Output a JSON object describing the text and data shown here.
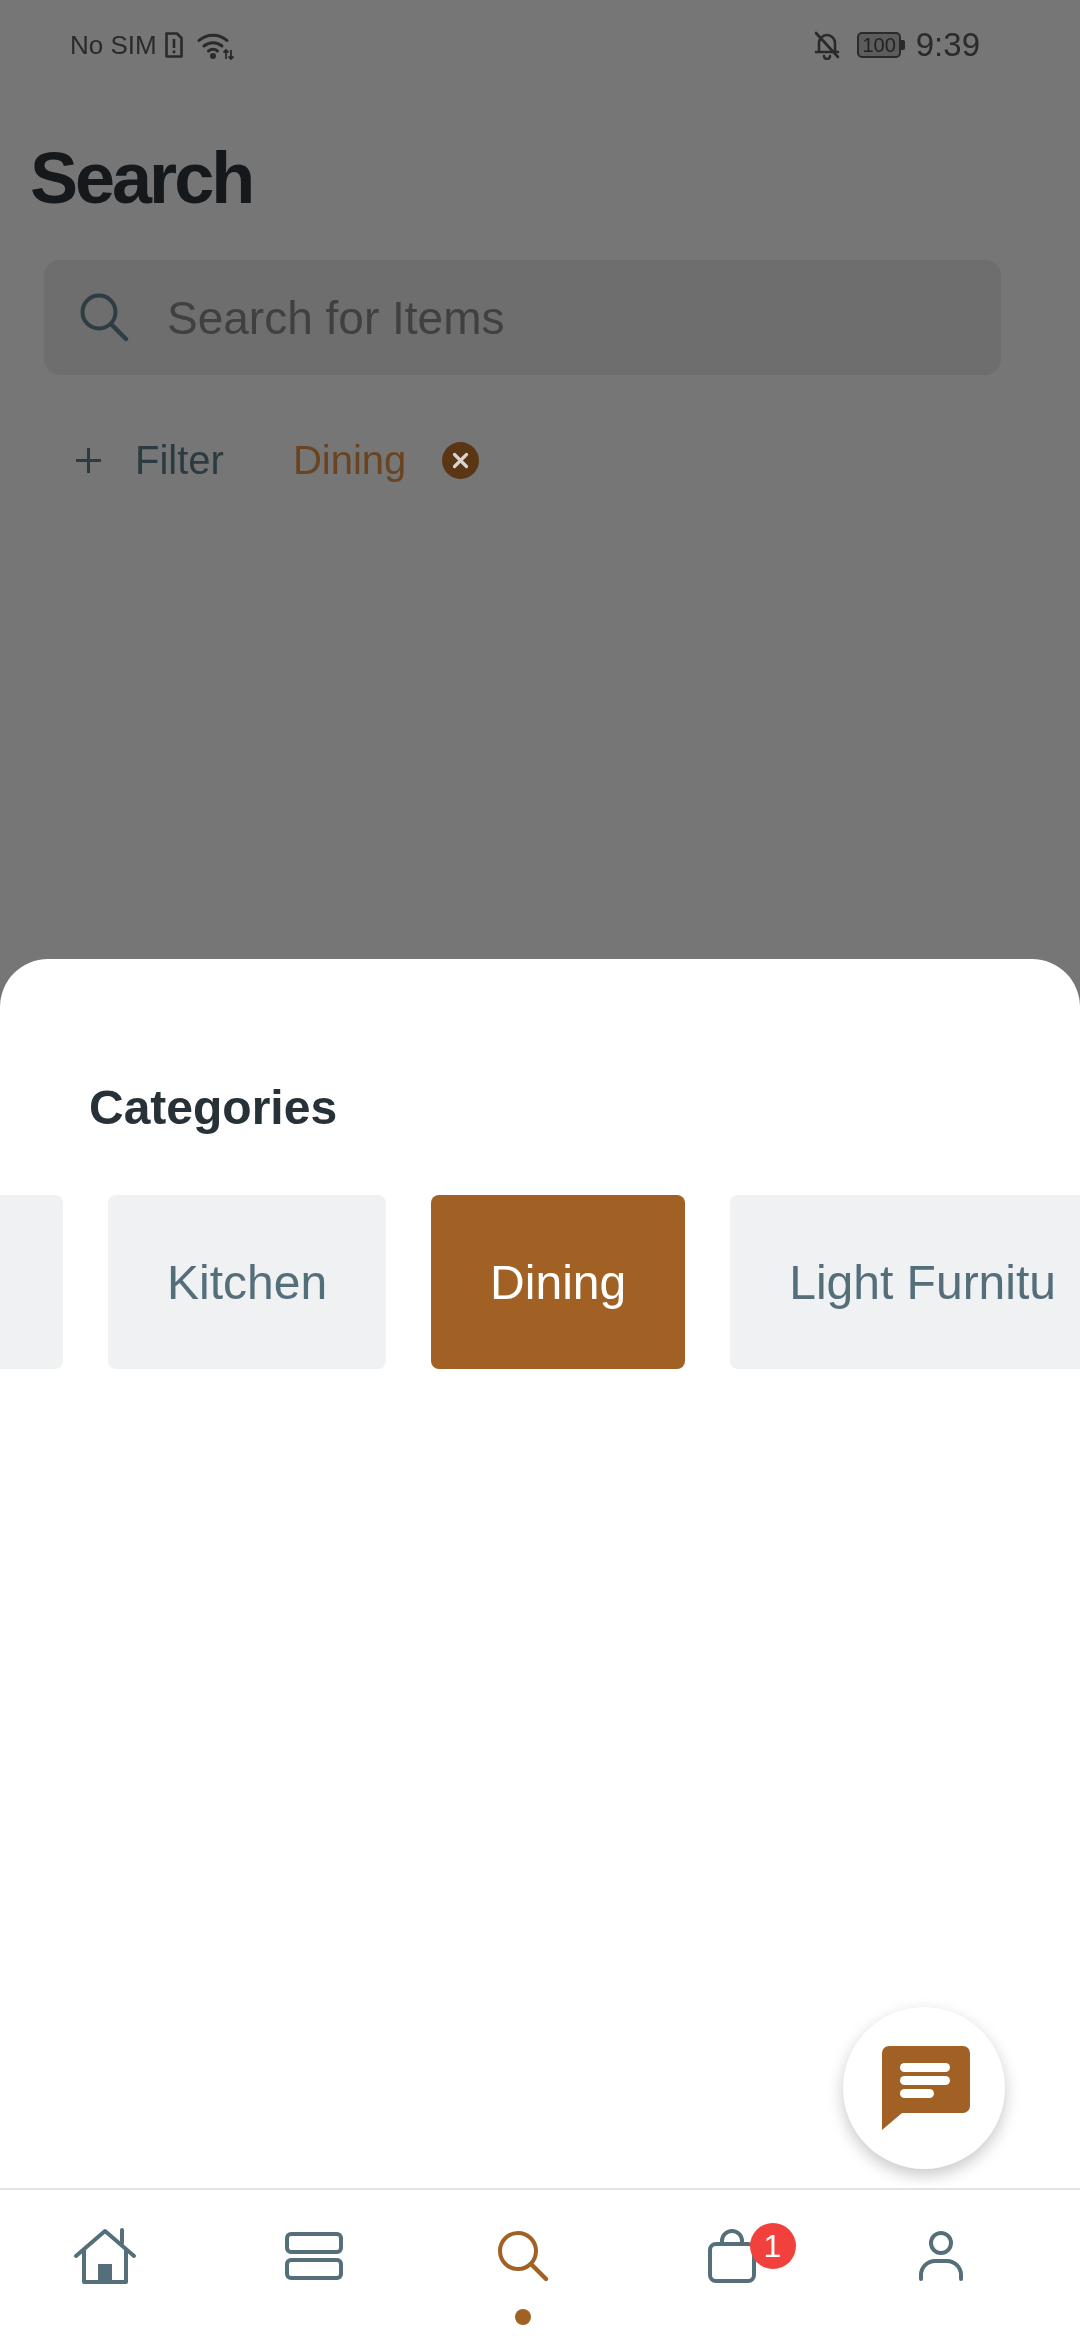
{
  "status_bar": {
    "carrier": "No SIM",
    "battery": "100",
    "time": "9:39"
  },
  "header": {
    "title": "Search"
  },
  "search": {
    "placeholder": "Search for Items"
  },
  "filters": {
    "add_label": "Filter",
    "active": [
      {
        "label": "Dining"
      }
    ]
  },
  "categories_sheet": {
    "title": "Categories",
    "categories": [
      {
        "selected": false
      },
      {
        "label": "Kitchen",
        "selected": false
      },
      {
        "label": "Dining",
        "selected": true
      },
      {
        "label": "Light Furnitu",
        "selected": false
      }
    ]
  },
  "bottom_nav": [
    {
      "kind": "home",
      "selected": false
    },
    {
      "kind": "list",
      "selected": false
    },
    {
      "kind": "search",
      "selected": true
    },
    {
      "kind": "bag",
      "selected": false,
      "badge": "1"
    },
    {
      "kind": "profile",
      "selected": false
    }
  ]
}
